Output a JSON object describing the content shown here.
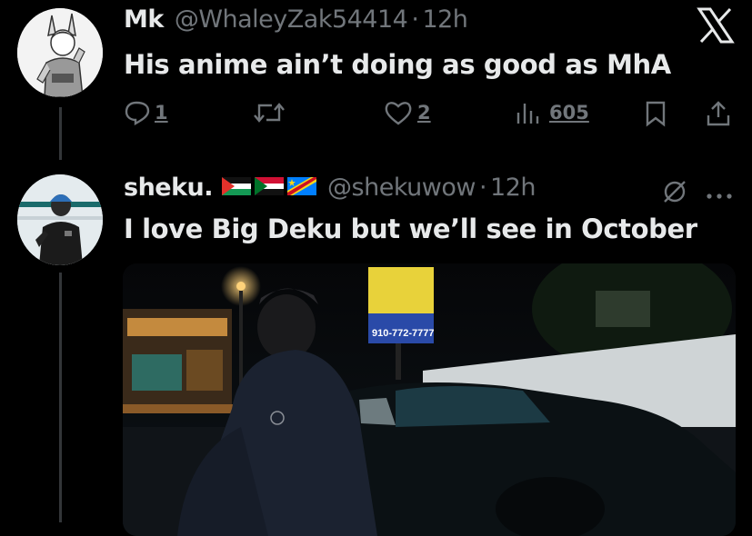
{
  "tweets": [
    {
      "name": "Mk",
      "handle": "@WhaleyZak54414",
      "time": "12h",
      "text": "His anime ain’t doing as good as MhA",
      "actions": {
        "reply_count": "1",
        "retweet_count": "",
        "like_count": "2",
        "view_count": "605"
      }
    },
    {
      "name": "sheku.",
      "flags": [
        "palestine-flag",
        "sudan-flag",
        "dr-congo-flag"
      ],
      "handle": "@shekuwow",
      "time": "12h",
      "text": "I love Big Deku but we’ll see in October",
      "media_sign_text": "910-772-7777"
    }
  ],
  "separator": "·",
  "colors": {
    "background": "#000000",
    "text_primary": "#e7e9ea",
    "text_secondary": "#71767b"
  }
}
